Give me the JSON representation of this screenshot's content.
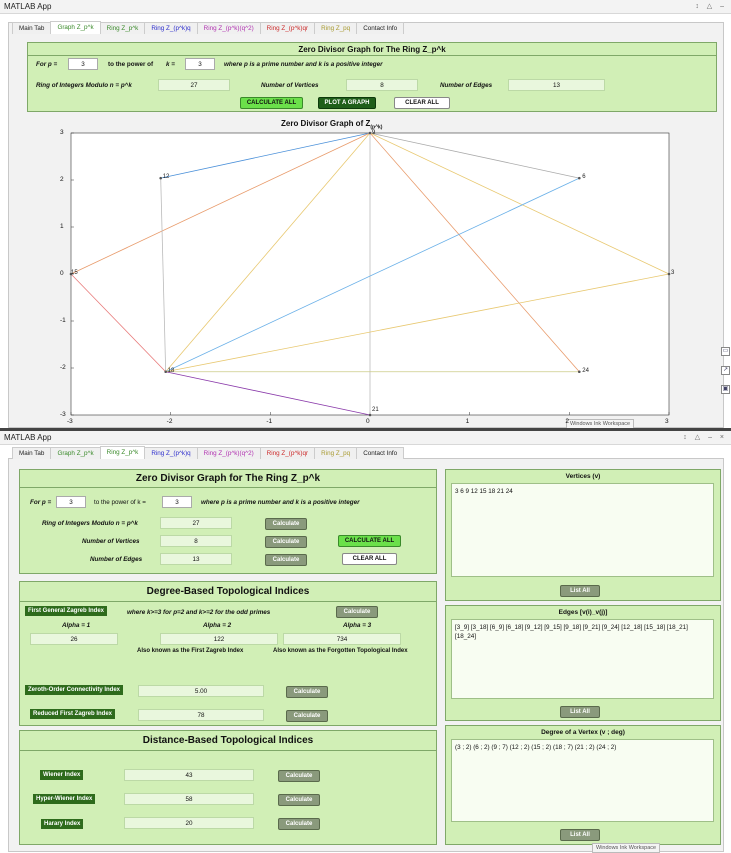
{
  "top": {
    "app_title": "MATLAB App",
    "window_controls": "↕ △ –",
    "tabs": [
      {
        "label": "Main Tab",
        "color": "#222222"
      },
      {
        "label": "Graph Z_p^k",
        "color": "#3a8a2a"
      },
      {
        "label": "Ring Z_p^k",
        "color": "#3a8a2a"
      },
      {
        "label": "Ring Z_(p^k)q",
        "color": "#2c2ccc"
      },
      {
        "label": "Ring Z_(p^k)(q^2)",
        "color": "#b030b0"
      },
      {
        "label": "Ring Z_(p^k)qr",
        "color": "#cc2a2a"
      },
      {
        "label": "Ring Z_pq",
        "color": "#a89a30"
      },
      {
        "label": "Contact Info",
        "color": "#222222"
      }
    ],
    "panel_title": "Zero Divisor Graph for The Ring Z_p^k",
    "for_label": "For p =",
    "p_value": "3",
    "power_label": "to the power of",
    "k_label": "k =",
    "k_value": "3",
    "hint": "where p is a prime number and k is a positive integer",
    "ring_label": "Ring of Integers Modulo n = p^k",
    "ring_value": "27",
    "vertices_label": "Number of Vertices",
    "vertices_value": "8",
    "edges_label": "Number of Edges",
    "edges_value": "13",
    "btn_calc_all": "CALCULATE ALL",
    "btn_plot": "PLOT A GRAPH",
    "btn_clear": "CLEAR ALL",
    "graph_title": "Zero Divisor Graph of Z",
    "graph_title_sub": "(p^k)",
    "x_ticks": [
      "-3",
      "-2",
      "-1",
      "0",
      "1",
      "2",
      "3"
    ],
    "y_ticks": [
      "3",
      "2",
      "1",
      "0",
      "-1",
      "-2",
      "-3"
    ],
    "nodes": [
      "9",
      "12",
      "6",
      "15",
      "3",
      "18",
      "24",
      "21"
    ],
    "tooltip": "Windows Ink Workspace"
  },
  "bottom": {
    "app_title": "MATLAB App",
    "window_controls": "↕ △ – ×",
    "tabs": [
      {
        "label": "Main Tab",
        "color": "#222222"
      },
      {
        "label": "Graph Z_p^k",
        "color": "#3a8a2a"
      },
      {
        "label": "Ring Z_p^k",
        "color": "#3a8a2a"
      },
      {
        "label": "Ring Z_(p^k)q",
        "color": "#2c2ccc"
      },
      {
        "label": "Ring Z_(p^k)(q^2)",
        "color": "#b030b0"
      },
      {
        "label": "Ring Z_(p^k)qr",
        "color": "#cc2a2a"
      },
      {
        "label": "Ring Z_pq",
        "color": "#a89a30"
      },
      {
        "label": "Contact Info",
        "color": "#222222"
      }
    ],
    "panel_title": "Zero Divisor Graph for The Ring Z_p^k",
    "for_label": "For p =",
    "p_value": "3",
    "power_label": "to the power of k =",
    "k_value": "3",
    "hint": "where p is a prime number and k is a positive integer",
    "ring_label": "Ring of Integers Modulo n = p^k",
    "ring_value": "27",
    "vertices_label": "Number of Vertices",
    "vertices_value": "8",
    "edges_label": "Number of Edges",
    "edges_value": "13",
    "btn_calculate": "Calculate",
    "btn_calc_all": "CALCULATE ALL",
    "btn_clear": "CLEAR ALL",
    "degree_title": "Degree-Based Topological Indices",
    "fgz_label": "First General Zagreb Index",
    "fgz_hint": "where k>=3 for p=2 and k>=2 for the odd primes",
    "alpha1_label": "Alpha = 1",
    "alpha2_label": "Alpha = 2",
    "alpha3_label": "Alpha = 3",
    "alpha1_value": "26",
    "alpha2_value": "122",
    "alpha3_value": "734",
    "alpha2_note": "Also known as the First Zagreb Index",
    "alpha3_note": "Also known as the Forgotten Topological Index",
    "zoc_label": "Zeroth-Order Connectivity Index",
    "zoc_value": "5.00",
    "rfz_label": "Reduced First Zagreb Index",
    "rfz_value": "78",
    "distance_title": "Distance-Based Topological Indices",
    "wiener_label": "Wiener Index",
    "wiener_value": "43",
    "hyper_label": "Hyper-Wiener Index",
    "hyper_value": "58",
    "harary_label": "Harary Index",
    "harary_value": "20",
    "vertices_panel_title": "Vertices (v)",
    "vertices_list": "3  6  9  12  15  18  21  24",
    "edges_panel_title": "Edges [v(i)_v(j)]",
    "edges_list": "[3_9]  [3_18]  [6_9]  [6_18]  [9_12]  [9_15]  [9_18]  [9_21]  [9_24]  [12_18]  [15_18]  [18_21]  [18_24]",
    "degree_panel_title": "Degree of a Vertex (v ; deg)",
    "degree_list": "(3 ; 2)  (6 ; 2)  (9 ; 7)  (12 ; 2)  (15 ; 2)  (18 ; 7)  (21 ; 2)  (24 ; 2)",
    "list_all": "List All",
    "tooltip": "Windows Ink Workspace"
  },
  "colors": {
    "panel_green": "#d1efb6",
    "accent_green": "#6be04a",
    "dark_green": "#1f5f1a"
  }
}
